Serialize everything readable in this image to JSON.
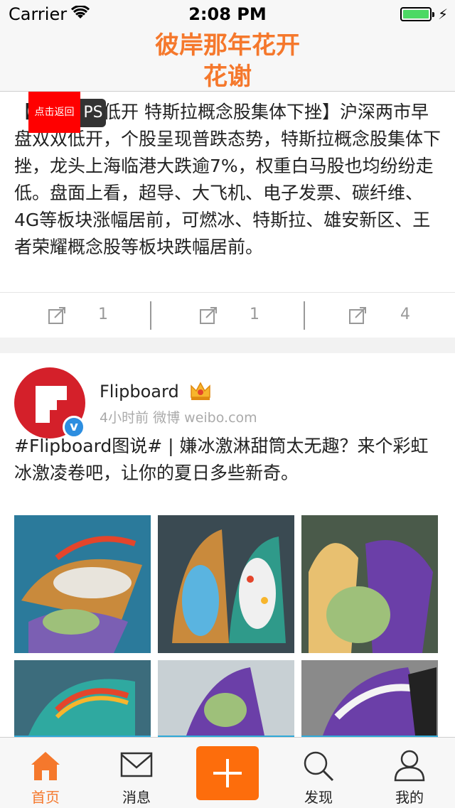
{
  "status_bar": {
    "carrier": "Carrier",
    "time": "2:08 PM"
  },
  "nav": {
    "title_line1": "彼岸那年花开",
    "title_line2": "花谢"
  },
  "card1": {
    "back_button": "点击返回",
    "ps_badge": "PS",
    "text": "【沪指小幅低开 特斯拉概念股集体下挫】沪深两市早盘双双低开，个股呈现普跌态势，特斯拉概念股集体下挫，龙头上海临港大跌逾7%，权重白马股也均纷纷走低。盘面上看，超导、大飞机、电子发票、碳纤维、4G等板块涨幅居前，可燃冰、特斯拉、雄安新区、王者荣耀概念股等板块跌幅居前。",
    "actions": [
      {
        "icon": "share-icon",
        "count": "1"
      },
      {
        "icon": "share-icon",
        "count": "1"
      },
      {
        "icon": "share-icon",
        "count": "4"
      }
    ]
  },
  "card2": {
    "username": "Flipboard",
    "meta": "4小时前  微博 weibo.com",
    "text": "#Flipboard图说# | 嫌冰激淋甜筒太无趣？来个彩虹冰激凌卷吧，让你的夏日多些新奇。",
    "photos": [
      {
        "icon": "taco-ice-cream-photo"
      },
      {
        "icon": "taco-ice-cream-photo"
      },
      {
        "icon": "taco-ice-cream-photo"
      },
      {
        "icon": "taco-ice-cream-photo"
      },
      {
        "icon": "taco-ice-cream-photo"
      },
      {
        "icon": "taco-ice-cream-photo"
      }
    ]
  },
  "tabbar": {
    "tabs": [
      {
        "label": "首页",
        "icon": "home-icon",
        "active": true
      },
      {
        "label": "消息",
        "icon": "envelope-icon",
        "active": false
      },
      {
        "label": "",
        "icon": "plus-icon",
        "active": false
      },
      {
        "label": "发现",
        "icon": "search-icon",
        "active": false
      },
      {
        "label": "我的",
        "icon": "person-icon",
        "active": false
      }
    ]
  },
  "colors": {
    "accent": "#f5782c",
    "plus_button": "#fd6d0c",
    "verify_badge": "#2d8ee0",
    "avatar": "#d4202a",
    "battery": "#4cd964"
  }
}
